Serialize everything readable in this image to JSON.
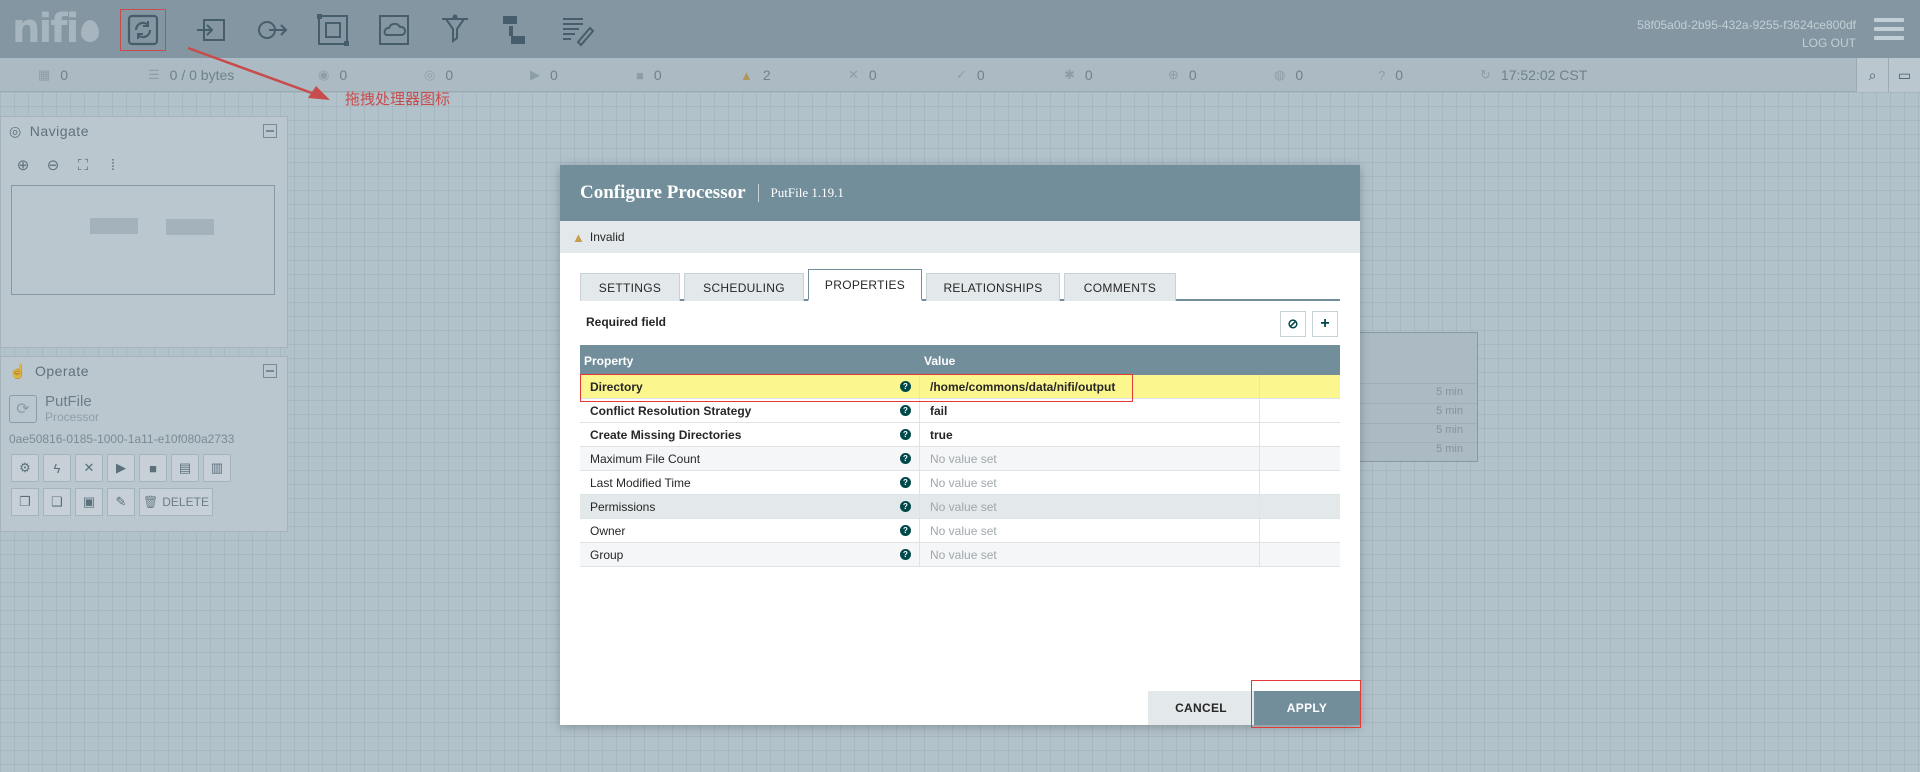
{
  "header": {
    "logo": "nifi",
    "user_id": "58f05a0d-2b95-432a-9255-f3624ce800df",
    "logout": "LOG OUT",
    "tools": [
      {
        "name": "processor",
        "icon": "processor-icon"
      },
      {
        "name": "input-port",
        "icon": "input-port-icon"
      },
      {
        "name": "output-port",
        "icon": "output-port-icon"
      },
      {
        "name": "process-group",
        "icon": "process-group-icon"
      },
      {
        "name": "remote-process-group",
        "icon": "remote-process-group-icon"
      },
      {
        "name": "funnel",
        "icon": "funnel-icon"
      },
      {
        "name": "template",
        "icon": "template-icon"
      },
      {
        "name": "label",
        "icon": "label-icon"
      }
    ]
  },
  "status": {
    "threads": "0",
    "queued": "0 / 0 bytes",
    "transmitting": "0",
    "not_transmitting": "0",
    "running": "0",
    "stopped": "0",
    "invalid": "2",
    "disabled": "0",
    "up_to_date": "0",
    "locally_modified": "0",
    "stale": "0",
    "locally_modified_stale": "0",
    "sync_failure": "0",
    "time": "17:52:02 CST"
  },
  "annotation": "拖拽处理器图标",
  "navigate": {
    "title": "Navigate"
  },
  "operate": {
    "title": "Operate",
    "name": "PutFile",
    "type": "Processor",
    "id": "0ae50816-0185-1000-1a11-e10f080a2733",
    "delete_label": "DELETE"
  },
  "background_group": {
    "rows": [
      "5 min",
      "5 min",
      "5 min",
      "5 min"
    ]
  },
  "dialog": {
    "title": "Configure Processor",
    "subtitle": "PutFile 1.19.1",
    "status": "Invalid",
    "tabs": [
      "SETTINGS",
      "SCHEDULING",
      "PROPERTIES",
      "RELATIONSHIPS",
      "COMMENTS"
    ],
    "active_tab": "PROPERTIES",
    "required_field": "Required field",
    "columns": {
      "property": "Property",
      "value": "Value"
    },
    "properties": [
      {
        "name": "Directory",
        "value": "/home/commons/data/nifi/output",
        "required": true
      },
      {
        "name": "Conflict Resolution Strategy",
        "value": "fail",
        "required": true
      },
      {
        "name": "Create Missing Directories",
        "value": "true",
        "required": true
      },
      {
        "name": "Maximum File Count",
        "value": "No value set",
        "required": false
      },
      {
        "name": "Last Modified Time",
        "value": "No value set",
        "required": false
      },
      {
        "name": "Permissions",
        "value": "No value set",
        "required": false
      },
      {
        "name": "Owner",
        "value": "No value set",
        "required": false
      },
      {
        "name": "Group",
        "value": "No value set",
        "required": false
      }
    ],
    "cancel": "CANCEL",
    "apply": "APPLY"
  },
  "colors": {
    "header": "#8a9ba6",
    "dialog_header": "#728e9b",
    "highlight_row": "#fcf68e",
    "annotation": "#e53935",
    "warning": "#c49d4e"
  }
}
